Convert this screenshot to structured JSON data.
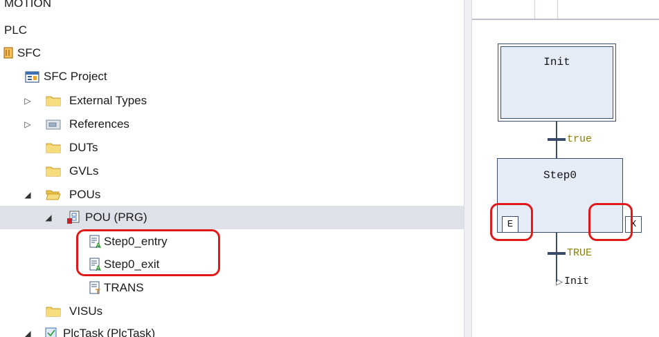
{
  "tree": {
    "items": [
      {
        "label": "MOTION"
      },
      {
        "label": "PLC"
      },
      {
        "label": "SFC"
      },
      {
        "label": "SFC Project"
      },
      {
        "label": "External Types"
      },
      {
        "label": "References"
      },
      {
        "label": "DUTs"
      },
      {
        "label": "GVLs"
      },
      {
        "label": "POUs"
      },
      {
        "label": "POU (PRG)"
      },
      {
        "label": "Step0_entry"
      },
      {
        "label": "Step0_exit"
      },
      {
        "label": "TRANS"
      },
      {
        "label": "VISUs"
      },
      {
        "label": "PlcTask (PlcTask)"
      }
    ],
    "selected": "POU (PRG)"
  },
  "sfc": {
    "init_step": "Init",
    "transition1": "true",
    "step0": "Step0",
    "entry_action": "E",
    "exit_action": "X",
    "transition2": "TRUE",
    "jump_target": "Init"
  },
  "colors": {
    "highlight": "#e01818",
    "step_fill": "#e6ebf8",
    "transition_text": "#8a7f00",
    "selection": "#dfe1e8"
  }
}
